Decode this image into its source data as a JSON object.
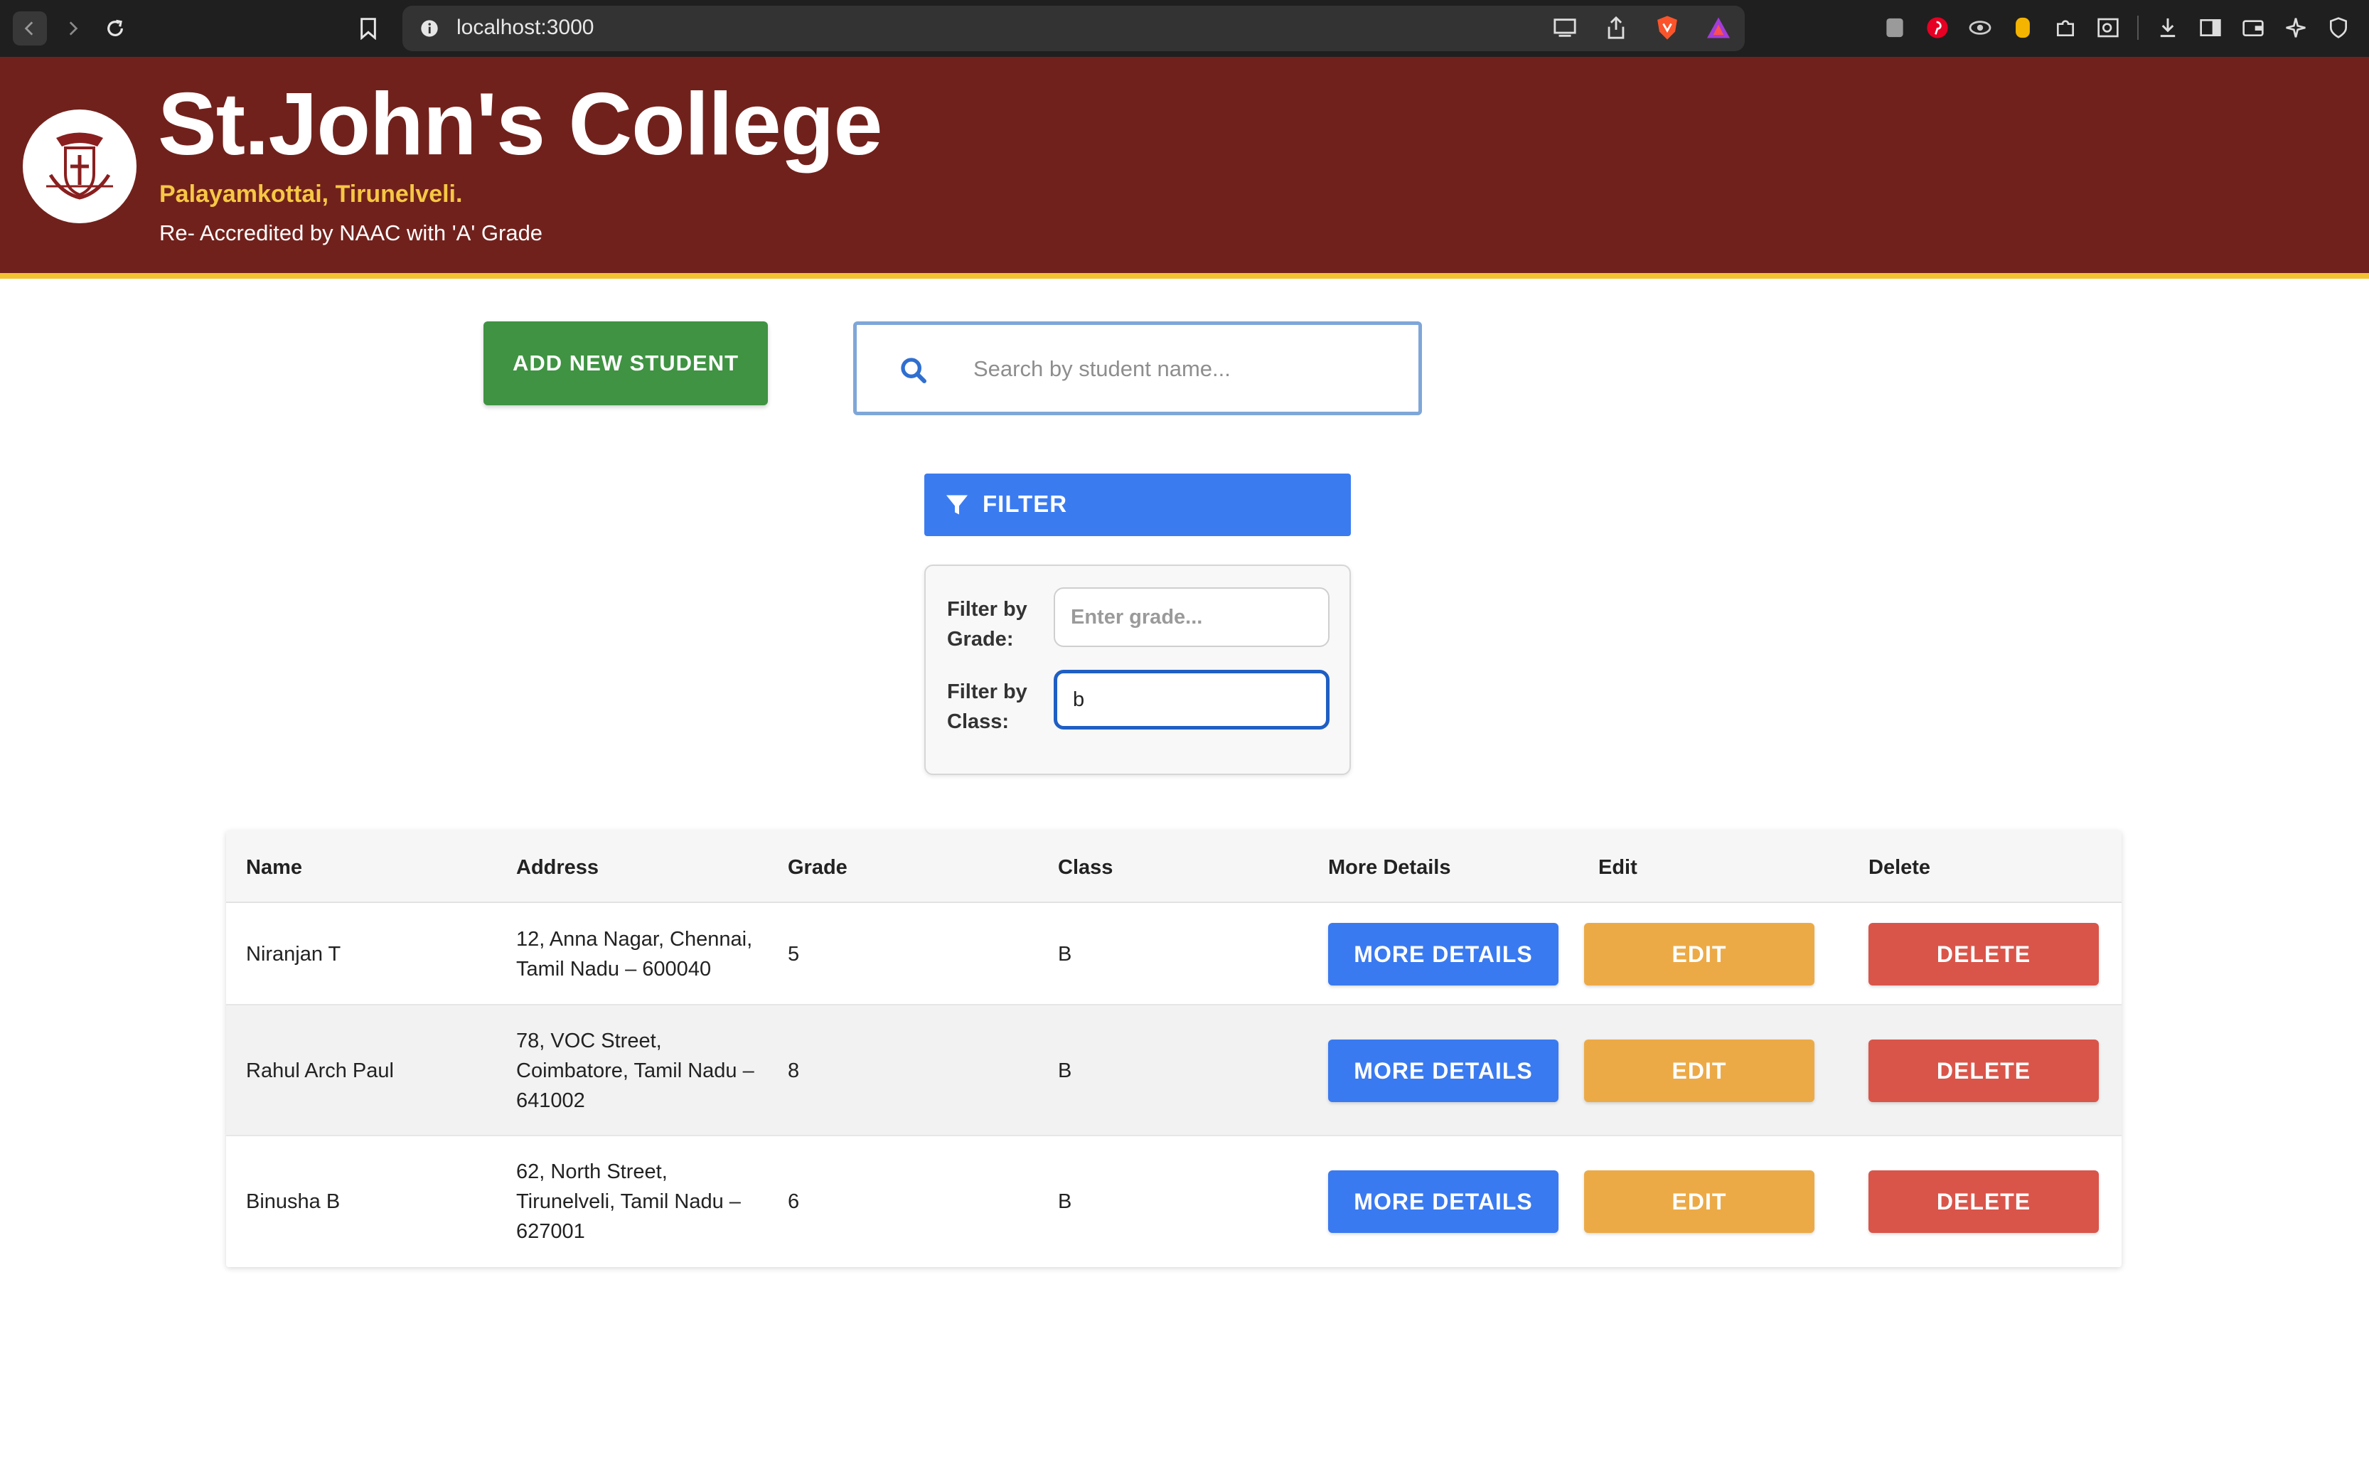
{
  "browser": {
    "url": "localhost:3000"
  },
  "header": {
    "title": "St.John's College",
    "subtitle": "Palayamkottai, Tirunelveli.",
    "accreditation": "Re- Accredited by NAAC with 'A' Grade"
  },
  "toolbar": {
    "add_label": "ADD NEW STUDENT",
    "search_placeholder": "Search by student name..."
  },
  "filter": {
    "button_label": "FILTER",
    "grade_label": "Filter by Grade:",
    "grade_placeholder": "Enter grade...",
    "grade_value": "",
    "class_label": "Filter by Class:",
    "class_value": "b"
  },
  "table": {
    "headers": [
      "Name",
      "Address",
      "Grade",
      "Class",
      "More Details",
      "Edit",
      "Delete"
    ],
    "rows": [
      {
        "name": "Niranjan T",
        "address": "12, Anna Nagar, Chennai, Tamil Nadu – 600040",
        "grade": "5",
        "class": "B"
      },
      {
        "name": "Rahul Arch Paul",
        "address": "78, VOC Street, Coimbatore, Tamil Nadu – 641002",
        "grade": "8",
        "class": "B"
      },
      {
        "name": "Binusha B",
        "address": "62, North Street, Tirunelveli, Tamil Nadu – 627001",
        "grade": "6",
        "class": "B"
      }
    ],
    "more_label": "MORE DETAILS",
    "edit_label": "EDIT",
    "delete_label": "DELETE"
  },
  "colors": {
    "header_bg": "#71211c",
    "accent_yellow": "#f2c230",
    "add_green": "#3f9342",
    "primary_blue": "#3b7bf0",
    "edit_orange": "#ecaa46",
    "delete_red": "#d9554a"
  }
}
